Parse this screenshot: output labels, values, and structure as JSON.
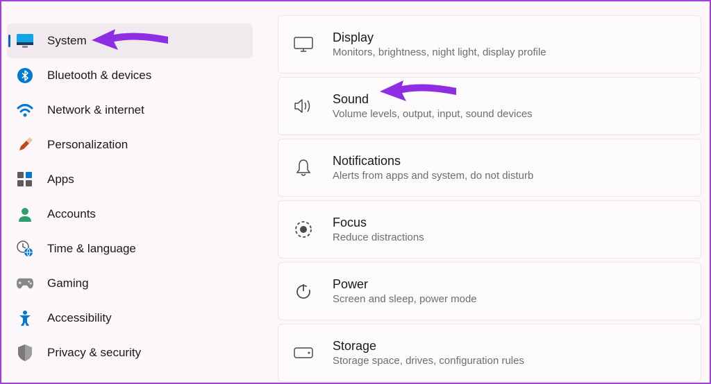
{
  "sidebar": {
    "items": [
      {
        "id": "system",
        "label": "System",
        "icon": "system-icon",
        "active": true
      },
      {
        "id": "bluetooth",
        "label": "Bluetooth & devices",
        "icon": "bluetooth-icon",
        "active": false
      },
      {
        "id": "network",
        "label": "Network & internet",
        "icon": "wifi-icon",
        "active": false
      },
      {
        "id": "personalization",
        "label": "Personalization",
        "icon": "paintbrush-icon",
        "active": false
      },
      {
        "id": "apps",
        "label": "Apps",
        "icon": "apps-icon",
        "active": false
      },
      {
        "id": "accounts",
        "label": "Accounts",
        "icon": "person-icon",
        "active": false
      },
      {
        "id": "time",
        "label": "Time & language",
        "icon": "clock-globe-icon",
        "active": false
      },
      {
        "id": "gaming",
        "label": "Gaming",
        "icon": "gamepad-icon",
        "active": false
      },
      {
        "id": "accessibility",
        "label": "Accessibility",
        "icon": "accessibility-icon",
        "active": false
      },
      {
        "id": "privacy",
        "label": "Privacy & security",
        "icon": "shield-icon",
        "active": false
      }
    ]
  },
  "main": {
    "cards": [
      {
        "id": "display",
        "title": "Display",
        "desc": "Monitors, brightness, night light, display profile",
        "icon": "monitor-icon"
      },
      {
        "id": "sound",
        "title": "Sound",
        "desc": "Volume levels, output, input, sound devices",
        "icon": "speaker-icon"
      },
      {
        "id": "notifications",
        "title": "Notifications",
        "desc": "Alerts from apps and system, do not disturb",
        "icon": "bell-icon"
      },
      {
        "id": "focus",
        "title": "Focus",
        "desc": "Reduce distractions",
        "icon": "focus-icon"
      },
      {
        "id": "power",
        "title": "Power",
        "desc": "Screen and sleep, power mode",
        "icon": "power-icon"
      },
      {
        "id": "storage",
        "title": "Storage",
        "desc": "Storage space, drives, configuration rules",
        "icon": "storage-icon"
      }
    ]
  },
  "annotations": {
    "arrow1_target": "system",
    "arrow2_target": "sound",
    "arrow_color": "#8e2de2"
  }
}
